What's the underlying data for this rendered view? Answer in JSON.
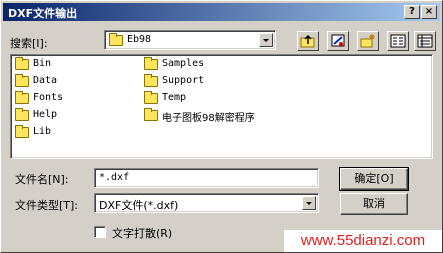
{
  "window": {
    "title": "DXF文件输出",
    "help_button": "?",
    "close_button": "×"
  },
  "lookin": {
    "label": "搜索[I]:",
    "value": "Eb98"
  },
  "toolbar": {
    "icons": [
      "up-one-level-icon",
      "desktop-icon",
      "new-folder-icon",
      "list-view-icon",
      "details-view-icon"
    ]
  },
  "files": {
    "col1": [
      "Bin",
      "Data",
      "Fonts",
      "Help",
      "Lib"
    ],
    "col2": [
      "Samples",
      "Support",
      "Temp",
      "电子图板98解密程序"
    ]
  },
  "filename": {
    "label": "文件名[N]:",
    "value": "*.dxf"
  },
  "filetype": {
    "label": "文件类型[T]:",
    "value": "DXF文件(*.dxf)"
  },
  "buttons": {
    "ok": "确定[O]",
    "cancel": "取消"
  },
  "checkbox": {
    "label": "文字打散(R)",
    "checked": false
  },
  "watermark": "www.55dianzi.com"
}
